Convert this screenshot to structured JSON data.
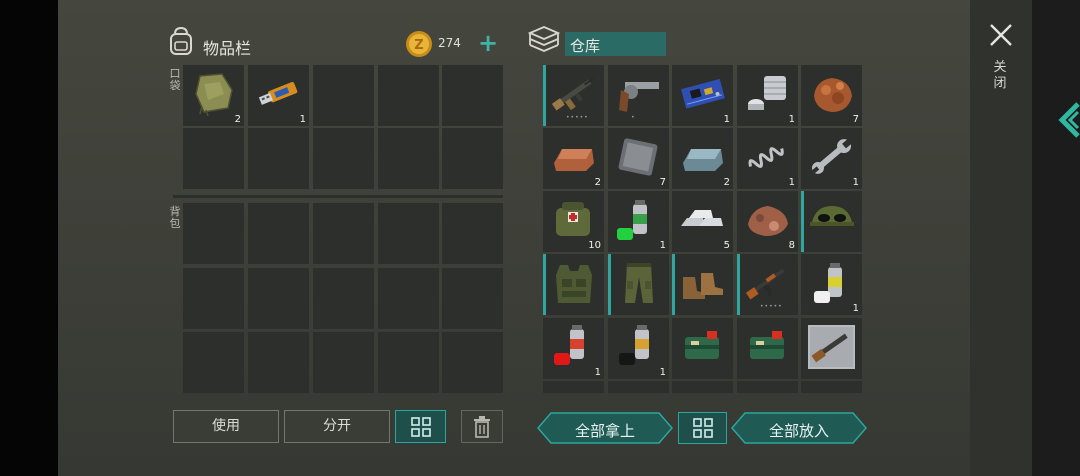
{
  "inventory": {
    "title": "物品栏",
    "coins": "274",
    "add_symbol": "+",
    "pocket_label": "口袋",
    "backpack_label": "背包",
    "pocket_slots": [
      {
        "item": "cloth",
        "qty": "2"
      },
      {
        "item": "usb-flash-drive",
        "qty": "1"
      },
      {
        "item": "",
        "qty": ""
      },
      {
        "item": "",
        "qty": ""
      },
      {
        "item": "",
        "qty": ""
      },
      {
        "item": "",
        "qty": ""
      },
      {
        "item": "",
        "qty": ""
      },
      {
        "item": "",
        "qty": ""
      },
      {
        "item": "",
        "qty": ""
      },
      {
        "item": "",
        "qty": ""
      }
    ],
    "buttons": {
      "use": "使用",
      "split": "分开"
    }
  },
  "warehouse": {
    "title": "仓库",
    "buttons": {
      "take_all": "全部拿上",
      "put_all": "全部放入"
    },
    "slots": [
      {
        "item": "assault-rifle",
        "qty": "",
        "equip": true,
        "durability": "•••••"
      },
      {
        "item": "revolver",
        "qty": "",
        "equip": false,
        "durability": "•"
      },
      {
        "item": "circuit-board",
        "qty": "1",
        "equip": false
      },
      {
        "item": "engine-parts",
        "qty": "1",
        "equip": false
      },
      {
        "item": "copper-ore",
        "qty": "7",
        "equip": false
      },
      {
        "item": "copper-ingot",
        "qty": "2",
        "equip": false
      },
      {
        "item": "iron-plate",
        "qty": "7",
        "equip": false
      },
      {
        "item": "steel-ingot",
        "qty": "2",
        "equip": false
      },
      {
        "item": "spring",
        "qty": "1",
        "equip": false
      },
      {
        "item": "wrench",
        "qty": "1",
        "equip": false
      },
      {
        "item": "first-aid-bag",
        "qty": "10",
        "equip": false
      },
      {
        "item": "green-spray-paint",
        "qty": "1",
        "equip": false
      },
      {
        "item": "silver-bars",
        "qty": "5",
        "equip": false
      },
      {
        "item": "iron-ore",
        "qty": "8",
        "equip": false
      },
      {
        "item": "camo-hat-sunglasses",
        "qty": "",
        "equip": true
      },
      {
        "item": "tactical-vest",
        "qty": "",
        "equip": true
      },
      {
        "item": "camo-pants",
        "qty": "",
        "equip": true
      },
      {
        "item": "boots",
        "qty": "",
        "equip": true
      },
      {
        "item": "ak-rifle",
        "qty": "",
        "equip": true,
        "durability": "•••••"
      },
      {
        "item": "white-spray-paint",
        "qty": "1",
        "equip": false
      },
      {
        "item": "red-spray-paint",
        "qty": "1",
        "equip": false
      },
      {
        "item": "black-spray-paint",
        "qty": "1",
        "equip": false
      },
      {
        "item": "explosive-charge",
        "qty": "",
        "equip": false
      },
      {
        "item": "explosive-charge",
        "qty": "",
        "equip": false
      },
      {
        "item": "shotgun-blueprint",
        "qty": "",
        "equip": false
      }
    ]
  },
  "side": {
    "close_label": "关闭"
  },
  "colors": {
    "accent": "#2da7a0",
    "title_bar": "#2b6b66",
    "coin": "#e1a82a",
    "slot": "#2c2f2b"
  },
  "icons": [
    "backpack-icon",
    "gold-coin-icon",
    "plus-icon",
    "warehouse-icon",
    "close-icon",
    "sort-grid-icon",
    "trash-icon",
    "side-arrow-icon"
  ]
}
